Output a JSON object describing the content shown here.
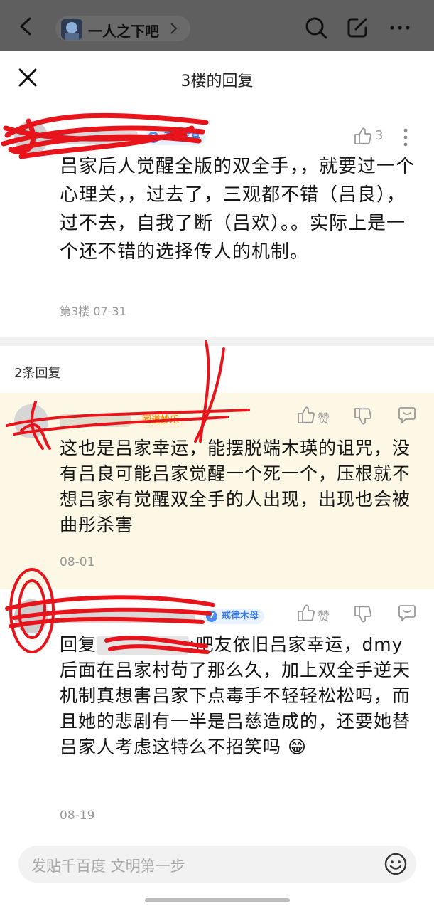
{
  "topbar": {
    "forum_name": "一人之下吧",
    "icons": [
      "back-icon",
      "search-icon",
      "edit-icon",
      "more-icon"
    ]
  },
  "sheet": {
    "title": "3楼的回复"
  },
  "post": {
    "badge_level": "9",
    "badge_text": "五雷玄冥",
    "like_count": "3",
    "text": "吕家后人觉醒全版的双全手，，就要过一个心理关，，过去了，三观都不错（吕良），过不去，自我了断（吕欢）。。实际上是一个还不错的选择传人的机制。",
    "meta": "第3楼 07-31"
  },
  "replies_header": "2条回复",
  "replies": [
    {
      "badge_text": "同道妙乐",
      "like_label": "赞",
      "text": "这也是吕家幸运，能摆脱端木瑛的诅咒，没有吕良可能吕家觉醒一个死一个，压根就不想吕家有觉醒双全手的人出现，出现也会被曲彤杀害",
      "date": "08-01"
    },
    {
      "badge_level": "7",
      "badge_text": "戒律木母",
      "like_label": "赞",
      "reply_prefix": "回复",
      "text": ":吧友依旧吕家幸运，dmy后面在吕家村苟了那么久，加上双全手逆天机制真想害吕家下点毒手不轻轻松松吗，而且她的悲剧有一半是吕慈造成的，还要她替吕家人考虑这特么不招笑吗 😁",
      "date": "08-19"
    }
  ],
  "input": {
    "placeholder": "发贴千百度 文明第一步"
  },
  "colors": {
    "topbar_bg": "#5f5f5f",
    "badge_blue": "#3a79e8",
    "badge_orange": "#f09a19",
    "highlight_bg": "#fdf8e6",
    "scribble_red": "#e8141c"
  }
}
